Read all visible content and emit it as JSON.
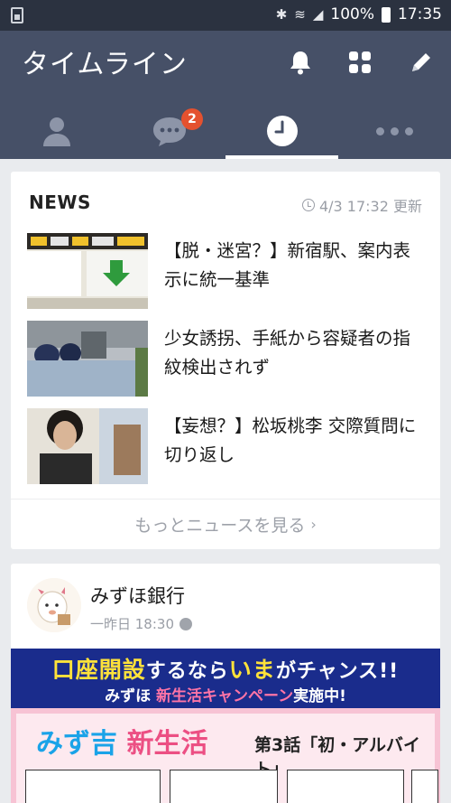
{
  "status_bar": {
    "battery": "100%",
    "time": "17:35"
  },
  "header": {
    "title": "タイムライン"
  },
  "tabs": {
    "chat_badge": "2"
  },
  "news": {
    "heading": "NEWS",
    "updated": "4/3 17:32 更新",
    "items": [
      {
        "title": "【脱・迷宮？】新宿駅、案内表示に統一基準"
      },
      {
        "title": "少女誘拐、手紙から容疑者の指紋検出されず"
      },
      {
        "title": "【妄想？】松坂桃李 交際質問に切り返し"
      }
    ],
    "more": "もっとニュースを見る"
  },
  "post": {
    "author": "みずほ銀行",
    "time": "一昨日 18:30",
    "banner": {
      "line1_a": "口座開設",
      "line1_b": "するなら",
      "line1_c": "いま",
      "line1_d": "がチャンス!!",
      "line2_a": "みずほ ",
      "line2_b": "新生活キャンペーン",
      "line2_c": "実施中!",
      "title_a": "みず吉 ",
      "title_b": "新生活",
      "episode": "第3話「初・アルバイト」"
    }
  },
  "colors": {
    "status_bar": "#2b3240",
    "header": "#465067",
    "badge": "#e4512f",
    "background": "#e9ebee"
  }
}
